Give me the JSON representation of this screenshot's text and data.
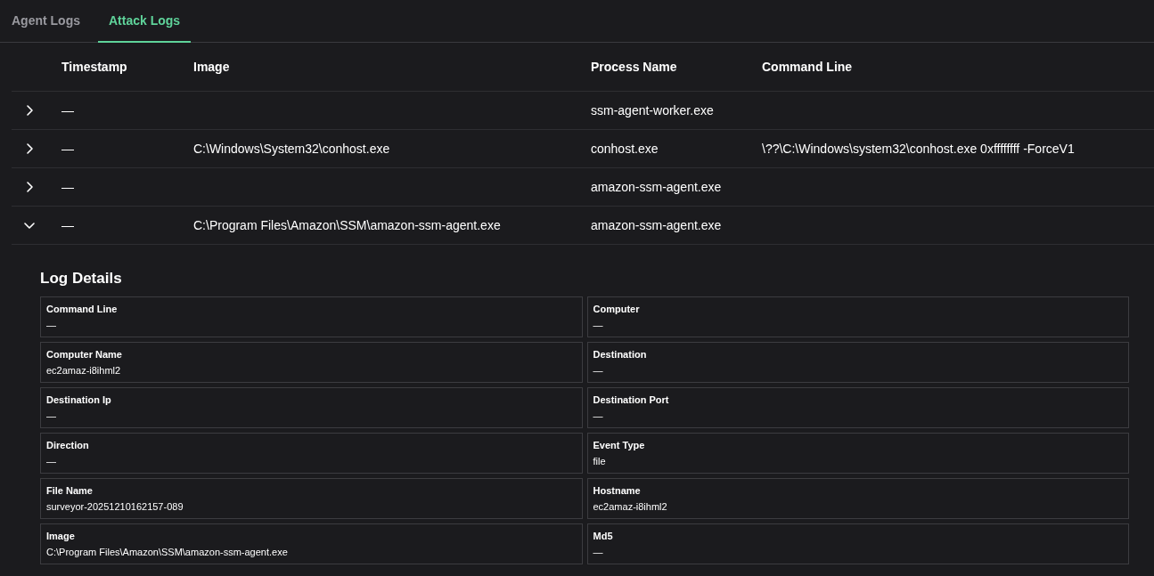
{
  "tabs": [
    {
      "label": "Agent Logs",
      "selected": false
    },
    {
      "label": "Attack Logs",
      "selected": true
    }
  ],
  "table": {
    "columns": [
      "Timestamp",
      "Image",
      "Process Name",
      "Command Line"
    ],
    "rows": [
      {
        "expanded": false,
        "timestamp": "—",
        "image": "",
        "process_name": "ssm-agent-worker.exe",
        "command_line": ""
      },
      {
        "expanded": false,
        "timestamp": "—",
        "image": "C:\\Windows\\System32\\conhost.exe",
        "process_name": "conhost.exe",
        "command_line": "\\??\\C:\\Windows\\system32\\conhost.exe 0xffffffff -ForceV1"
      },
      {
        "expanded": false,
        "timestamp": "—",
        "image": "",
        "process_name": "amazon-ssm-agent.exe",
        "command_line": ""
      },
      {
        "expanded": true,
        "timestamp": "—",
        "image": "C:\\Program Files\\Amazon\\SSM\\amazon-ssm-agent.exe",
        "process_name": "amazon-ssm-agent.exe",
        "command_line": ""
      }
    ]
  },
  "log_details": {
    "title": "Log Details",
    "fields": [
      {
        "label": "Command Line",
        "value": "—"
      },
      {
        "label": "Computer",
        "value": "—"
      },
      {
        "label": "Computer Name",
        "value": "ec2amaz-i8ihml2"
      },
      {
        "label": "Destination",
        "value": "—"
      },
      {
        "label": "Destination Ip",
        "value": "—"
      },
      {
        "label": "Destination Port",
        "value": "—"
      },
      {
        "label": "Direction",
        "value": "—"
      },
      {
        "label": "Event Type",
        "value": "file"
      },
      {
        "label": "File Name",
        "value": "surveyor-20251210162157-089"
      },
      {
        "label": "Hostname",
        "value": "ec2amaz-i8ihml2"
      },
      {
        "label": "Image",
        "value": "C:\\Program Files\\Amazon\\SSM\\amazon-ssm-agent.exe"
      },
      {
        "label": "Md5",
        "value": "—"
      }
    ]
  }
}
